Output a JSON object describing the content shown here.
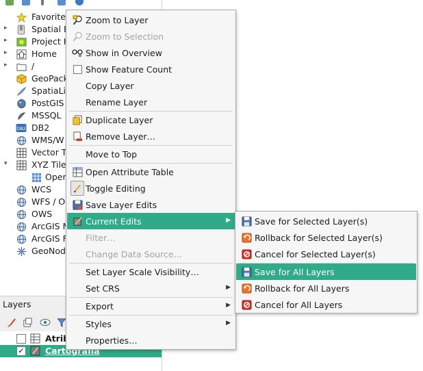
{
  "colors": {
    "accent": "#2fab8a",
    "menu_bg": "#f6f6f6",
    "disabled_text": "#a3a3a3"
  },
  "browser": {
    "items": [
      {
        "label": "Favorites",
        "icon": "star-icon",
        "arrow": ""
      },
      {
        "label": "Spatial B",
        "icon": "bookmark-icon",
        "arrow": "▸"
      },
      {
        "label": "Project H",
        "icon": "project-home-icon",
        "arrow": "▸"
      },
      {
        "label": "Home",
        "icon": "home-icon",
        "arrow": "▸"
      },
      {
        "label": "/",
        "icon": "folder-icon",
        "arrow": "▸"
      },
      {
        "label": "GeoPack",
        "icon": "geopackage-icon",
        "arrow": ""
      },
      {
        "label": "SpatiaLit",
        "icon": "spatialite-icon",
        "arrow": ""
      },
      {
        "label": "PostGIS",
        "icon": "postgis-icon",
        "arrow": ""
      },
      {
        "label": "MSSQL",
        "icon": "mssql-icon",
        "arrow": ""
      },
      {
        "label": "DB2",
        "icon": "db2-icon",
        "arrow": ""
      },
      {
        "label": "WMS/W",
        "icon": "wms-icon",
        "arrow": ""
      },
      {
        "label": "Vector Ti",
        "icon": "vector-tiles-icon",
        "arrow": ""
      },
      {
        "label": "XYZ Tiles",
        "icon": "xyz-tiles-icon",
        "arrow": "▾"
      },
      {
        "label": "Open",
        "icon": "grid-icon",
        "arrow": "",
        "child": true
      },
      {
        "label": "WCS",
        "icon": "globe-icon",
        "arrow": ""
      },
      {
        "label": "WFS / O",
        "icon": "globe-icon",
        "arrow": ""
      },
      {
        "label": "OWS",
        "icon": "globe-icon",
        "arrow": ""
      },
      {
        "label": "ArcGIS M",
        "icon": "globe-icon",
        "arrow": ""
      },
      {
        "label": "ArcGIS F",
        "icon": "globe-icon",
        "arrow": ""
      },
      {
        "label": "GeoNode",
        "icon": "geonode-icon",
        "arrow": ""
      }
    ]
  },
  "layers": {
    "title": "Layers",
    "rows": [
      {
        "label": "Atributo",
        "checked": "",
        "selected": false
      },
      {
        "label": "Cartografia",
        "checked": "✓",
        "selected": true
      }
    ]
  },
  "context_menu": {
    "items": [
      {
        "label": "Zoom to Layer",
        "icon": "zoom-layer-icon"
      },
      {
        "label": "Zoom to Selection",
        "icon": "zoom-selection-icon",
        "disabled": true
      },
      {
        "label": "Show in Overview",
        "icon": "overview-icon"
      },
      {
        "label": "Show Feature Count",
        "icon": "checkbox-icon"
      },
      {
        "label": "Copy Layer"
      },
      {
        "label": "Rename Layer"
      },
      {
        "label": "Duplicate Layer",
        "icon": "duplicate-icon"
      },
      {
        "label": "Remove Layer…",
        "icon": "remove-layer-icon"
      },
      {
        "label": "Move to Top"
      },
      {
        "label": "Open Attribute Table",
        "icon": "attribute-table-icon"
      },
      {
        "label": "Toggle Editing",
        "icon": "pencil-icon"
      },
      {
        "label": "Save Layer Edits",
        "icon": "save-edits-icon"
      },
      {
        "label": "Current Edits",
        "icon": "current-edits-icon",
        "submenu": true,
        "highlighted": true
      },
      {
        "label": "Filter…",
        "disabled": true
      },
      {
        "label": "Change Data Source…",
        "disabled": true
      },
      {
        "label": "Set Layer Scale Visibility…"
      },
      {
        "label": "Set CRS",
        "submenu": true
      },
      {
        "label": "Export",
        "submenu": true
      },
      {
        "label": "Styles",
        "submenu": true
      },
      {
        "label": "Properties…"
      }
    ]
  },
  "submenu": {
    "items": [
      {
        "label": "Save for Selected Layer(s)",
        "icon": "save-selected-icon"
      },
      {
        "label": "Rollback for Selected Layer(s)",
        "icon": "rollback-selected-icon"
      },
      {
        "label": "Cancel for Selected Layer(s)",
        "icon": "cancel-selected-icon"
      },
      {
        "label": "Save for All Layers",
        "icon": "save-all-icon",
        "highlighted": true
      },
      {
        "label": "Rollback for All Layers",
        "icon": "rollback-all-icon"
      },
      {
        "label": "Cancel for All Layers",
        "icon": "cancel-all-icon"
      }
    ]
  }
}
